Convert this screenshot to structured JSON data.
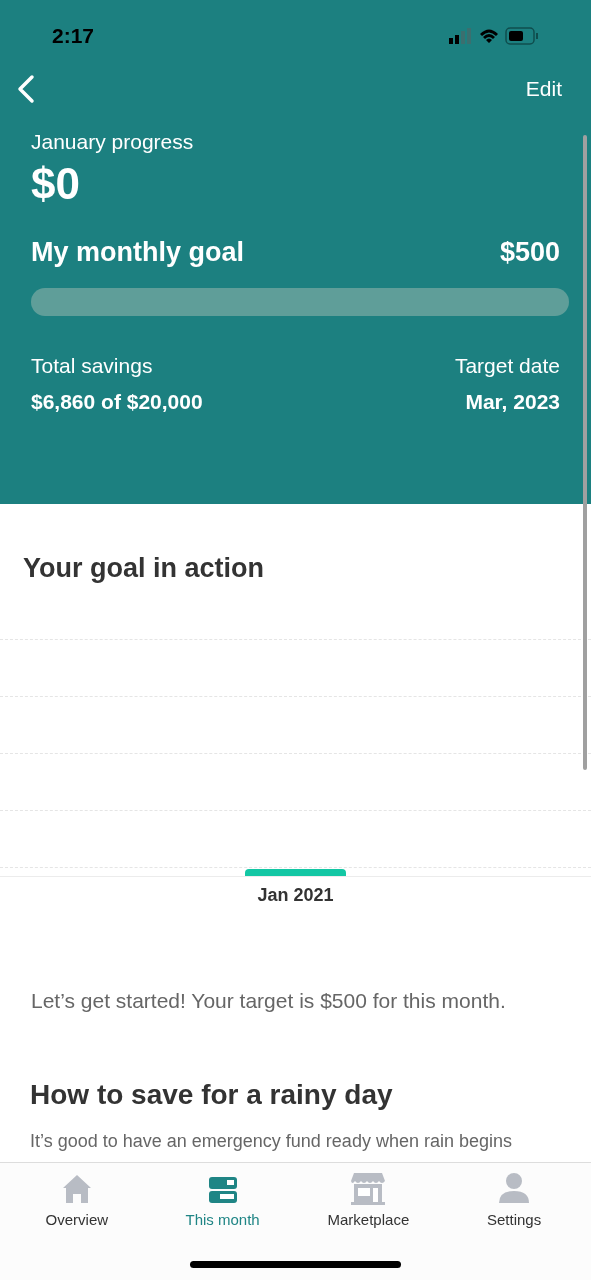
{
  "status_bar": {
    "time": "2:17"
  },
  "nav": {
    "edit": "Edit"
  },
  "progress": {
    "label": "January progress",
    "amount": "$0",
    "goal_label": "My monthly goal",
    "goal_amount": "$500",
    "level": 0,
    "total_label": "Total savings",
    "total_value": "$6,860 of $20,000",
    "target_label": "Target date",
    "target_value": "Mar, 2023"
  },
  "goal_section": {
    "title": "Your goal in action",
    "month": "Jan 2021",
    "message": "Let’s get started! Your target is $500 for this month."
  },
  "article": {
    "title": "How to save for a rainy day",
    "text": "It’s good to have an emergency fund ready when rain begins"
  },
  "tabs": [
    {
      "label": "Overview",
      "kind": "home",
      "selected": false
    },
    {
      "label": "This month",
      "kind": "month",
      "selected": true
    },
    {
      "label": "Marketplace",
      "kind": "store",
      "selected": false
    },
    {
      "label": "Settings",
      "kind": "person",
      "selected": false
    }
  ]
}
